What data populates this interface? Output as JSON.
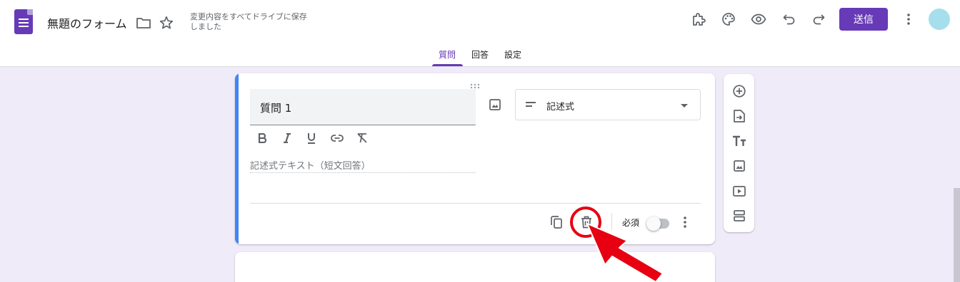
{
  "header": {
    "form_title": "無題のフォーム",
    "save_status": "変更内容をすべてドライブに保存しました",
    "send_label": "送信"
  },
  "tabs": [
    {
      "label": "質問",
      "active": true
    },
    {
      "label": "回答",
      "active": false
    },
    {
      "label": "設定",
      "active": false
    }
  ],
  "question": {
    "title": "質問 1",
    "type": "記述式",
    "answer_placeholder": "記述式テキスト（短文回答）",
    "required_label": "必須",
    "required": false
  },
  "colors": {
    "accent": "#673ab7",
    "background": "#f0ebf8",
    "active_card_bar": "#4285f4",
    "annotation": "#e60012"
  },
  "icons": {
    "header": [
      "forms-app-icon",
      "folder-icon",
      "star-icon",
      "addon-puzzle-icon",
      "palette-icon",
      "preview-eye-icon",
      "undo-icon",
      "redo-icon",
      "more-vert-icon"
    ],
    "format_bar": [
      "bold-icon",
      "italic-icon",
      "underline-icon",
      "link-icon",
      "clear-format-icon"
    ],
    "side_toolbar": [
      "add-question-icon",
      "import-questions-icon",
      "add-title-icon",
      "add-image-icon",
      "add-video-icon",
      "add-section-icon"
    ],
    "card_footer": [
      "duplicate-icon",
      "delete-icon",
      "more-vert-icon"
    ]
  }
}
